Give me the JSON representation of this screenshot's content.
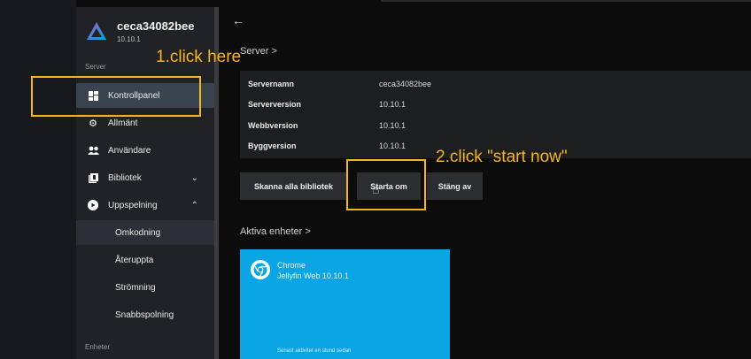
{
  "app": {
    "server_name": "ceca34082bee",
    "version": "10.10.1"
  },
  "sidebar": {
    "section_server": "Server",
    "items": [
      {
        "label": "Kontrollpanel",
        "icon": "dashboard-icon",
        "active": true
      },
      {
        "label": "Allmänt",
        "icon": "gear-icon"
      },
      {
        "label": "Användare",
        "icon": "users-icon"
      },
      {
        "label": "Bibliotek",
        "icon": "library-icon",
        "expand": "chevron-down"
      },
      {
        "label": "Uppspelning",
        "icon": "play-circle-icon",
        "expand": "chevron-up"
      }
    ],
    "sub_items": [
      {
        "label": "Omkodning",
        "active": true
      },
      {
        "label": "Återuppta"
      },
      {
        "label": "Strömning"
      },
      {
        "label": "Snabbspolning"
      }
    ],
    "section_devices": "Enheter"
  },
  "main": {
    "server_heading": "Server >",
    "info": [
      {
        "key": "Servernamn",
        "value": "ceca34082bee"
      },
      {
        "key": "Serverversion",
        "value": "10.10.1"
      },
      {
        "key": "Webbversion",
        "value": "10.10.1"
      },
      {
        "key": "Byggversion",
        "value": "10.10.1"
      }
    ],
    "buttons": {
      "scan": "Skanna alla bibliotek",
      "restart": "Starta om",
      "shutdown": "Stäng av"
    },
    "devices_heading": "Aktiva enheter >",
    "device": {
      "name": "Chrome",
      "client": "Jellyfin Web 10.10.1",
      "footer": "Senast aktivitet en stund sedan"
    }
  },
  "annotations": {
    "step1": "1.click here",
    "step2": "2.click \"start now\""
  },
  "colors": {
    "annotation": "#f6b61c",
    "device_card": "#0aa6e3",
    "active_nav": "#3a4450"
  }
}
